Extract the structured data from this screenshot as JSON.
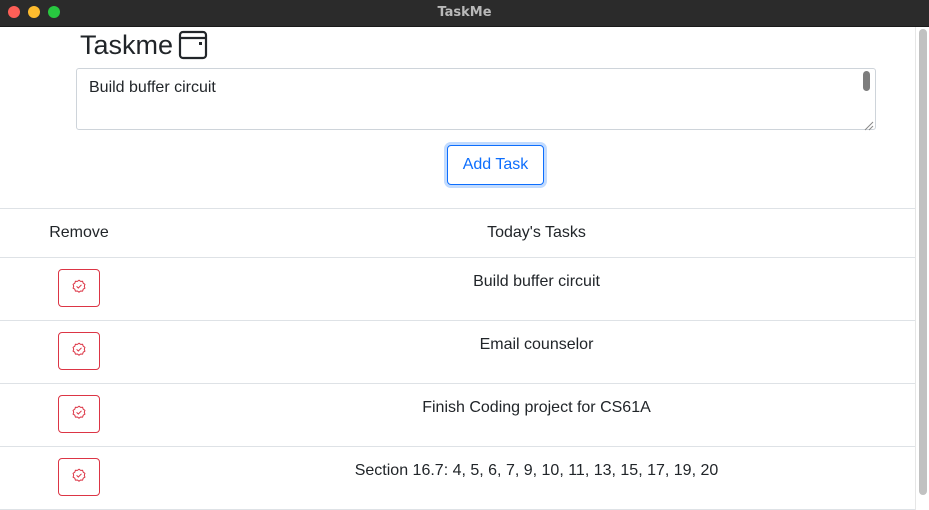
{
  "window": {
    "title": "TaskMe"
  },
  "app": {
    "title": "Taskme",
    "icon": "app-window-icon"
  },
  "input": {
    "value": "Build buffer circuit",
    "placeholder": ""
  },
  "add_button": {
    "label": "Add Task"
  },
  "table": {
    "headers": {
      "remove": "Remove",
      "tasks": "Today's Tasks"
    },
    "rows": [
      {
        "task": "Build buffer circuit",
        "remove_icon": "check-badge-icon"
      },
      {
        "task": "Email counselor",
        "remove_icon": "check-badge-icon"
      },
      {
        "task": "Finish Coding project for CS61A",
        "remove_icon": "check-badge-icon"
      },
      {
        "task": "Section 16.7: 4, 5, 6, 7, 9, 10, 11, 13, 15, 17, 19, 20",
        "remove_icon": "check-badge-icon"
      }
    ]
  },
  "colors": {
    "primary": "#0d6efd",
    "danger": "#dc3545",
    "titlebar": "#2b2b2b"
  }
}
